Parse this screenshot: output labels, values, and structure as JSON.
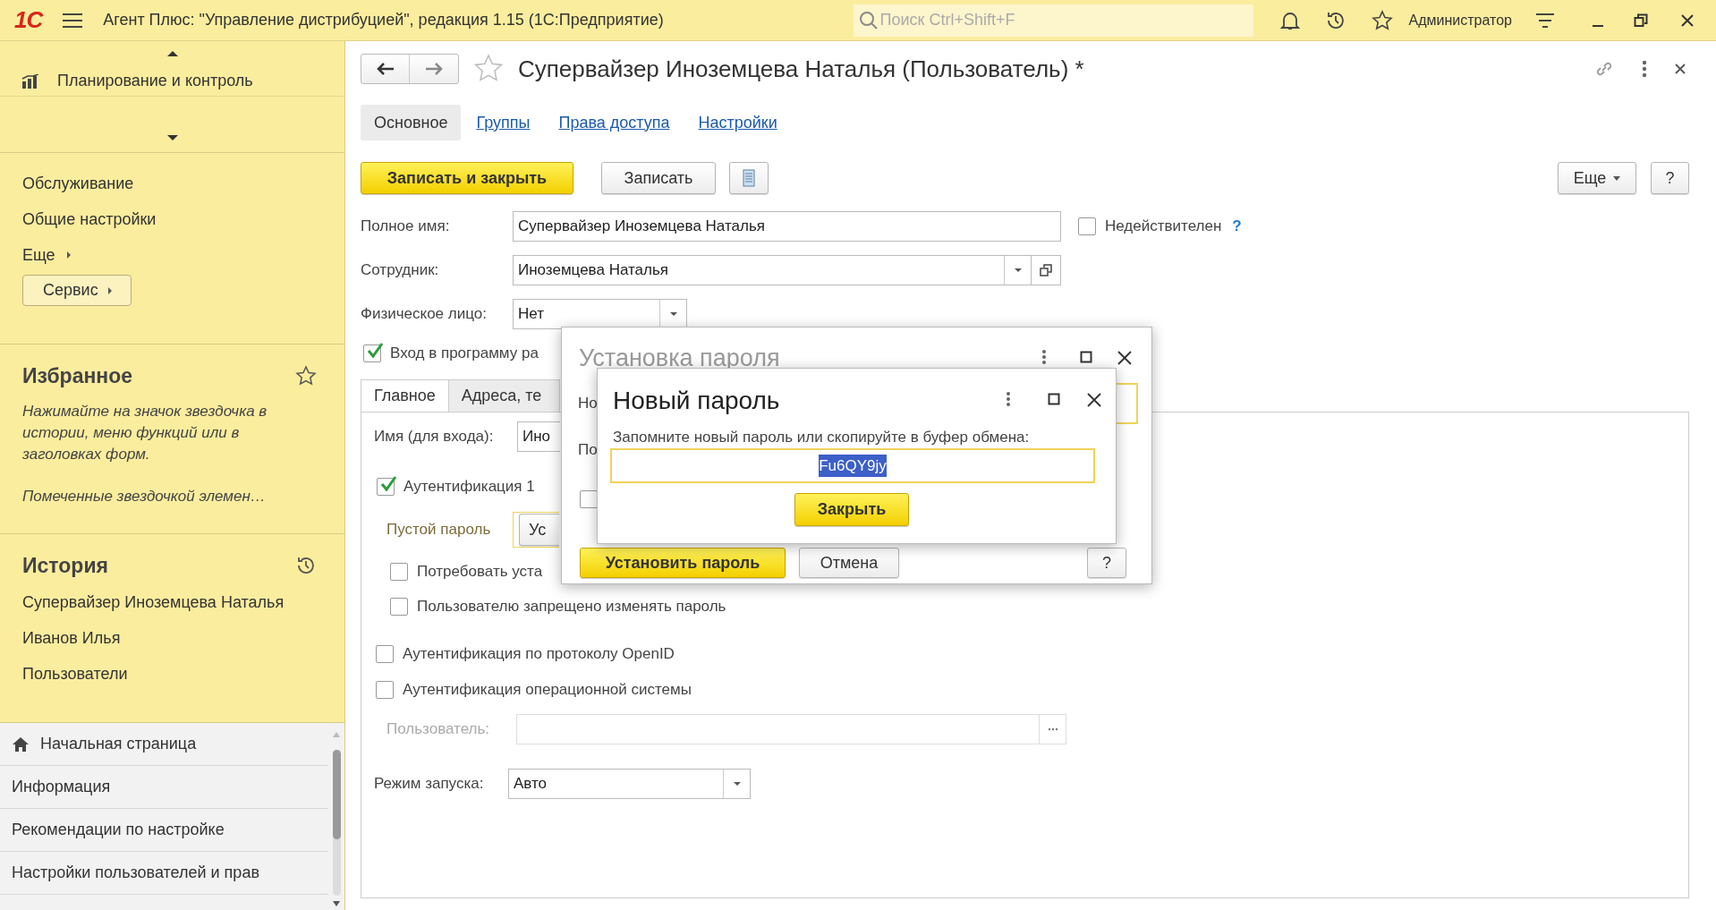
{
  "window": {
    "logo": "1С",
    "title": "Агент Плюс: \"Управление дистрибуцией\", редакция 1.15  (1С:Предприятие)",
    "search": {
      "placeholder": "Поиск Ctrl+Shift+F"
    },
    "user": "Администратор"
  },
  "sidebar": {
    "sections": [
      {
        "label": "Планирование и контроль"
      }
    ],
    "functions": [
      {
        "label": "Обслуживание",
        "kind": "link"
      },
      {
        "label": "Общие настройки",
        "kind": "link"
      },
      {
        "label": "Еще",
        "kind": "submenu"
      },
      {
        "label": "Сервис",
        "kind": "button"
      }
    ],
    "favorites": {
      "title": "Избранное",
      "hint": "Нажимайте на значок звездочка в истории, меню функций или в заголовках форм.",
      "note": "Помеченные звездочкой элемен…"
    },
    "history": {
      "title": "История",
      "items": [
        "Супервайзер Иноземцева Наталья",
        "Иванов Илья",
        "Пользователи"
      ]
    },
    "open_windows": [
      {
        "label": "Начальная страница",
        "kind": "home"
      },
      {
        "label": "Информация",
        "kind": "page"
      },
      {
        "label": "Рекомендации по настройке",
        "kind": "page"
      },
      {
        "label": "Настройки пользователей и прав",
        "kind": "page"
      }
    ]
  },
  "form": {
    "title": "Супервайзер Иноземцева Наталья (Пользователь) *",
    "tabs": [
      {
        "label": "Основное",
        "selected": true
      },
      {
        "label": "Группы",
        "selected": false
      },
      {
        "label": "Права доступа",
        "selected": false
      },
      {
        "label": "Настройки",
        "selected": false
      }
    ],
    "commands": {
      "save_close": "Записать и закрыть",
      "save": "Записать",
      "more": "Еще",
      "help": "?"
    },
    "full_name": {
      "label": "Полное имя:",
      "value": "Супервайзер Иноземцева Наталья"
    },
    "inactive": {
      "label": "Недействителен",
      "checked": false,
      "help": "?"
    },
    "employee": {
      "label": "Сотрудник:",
      "value": "Иноземцева Наталья"
    },
    "person": {
      "label": "Физическое лицо:",
      "value": "Нет"
    },
    "login_allowed": {
      "label": "Вход в программу ра",
      "checked": true
    },
    "inner_tabs": [
      {
        "label": "Главное",
        "selected": true
      },
      {
        "label": "Адреса, те",
        "selected": false
      }
    ],
    "login_name": {
      "label": "Имя (для входа):",
      "value": "Ино"
    },
    "auth_1c": {
      "label": "Аутентификация 1",
      "checked": true
    },
    "empty_password": {
      "label": "Пустой пароль",
      "button": "Ус"
    },
    "options": [
      {
        "label": "Потребовать уста",
        "checked": false
      },
      {
        "label": "Пользователю запрещено изменять пароль",
        "checked": false
      }
    ],
    "auth_other": [
      {
        "label": "Аутентификация по протоколу OpenID",
        "checked": false
      },
      {
        "label": "Аутентификация операционной системы",
        "checked": false
      }
    ],
    "os_user": {
      "label": "Пользователь:",
      "disabled": true
    },
    "launch_mode": {
      "label": "Режим запуска:",
      "value": "Авто"
    }
  },
  "set_password_dialog": {
    "title": "Установка пароля",
    "labels": [
      "Но",
      "По"
    ],
    "checkbox": {
      "checked": false
    },
    "buttons": {
      "ok": "Установить пароль",
      "cancel": "Отмена",
      "help": "?"
    }
  },
  "new_password_dialog": {
    "title": "Новый пароль",
    "message": "Запомните новый пароль или скопируйте в буфер обмена:",
    "password": {
      "value": "Fu6QY9jy",
      "selected": true
    },
    "close": "Закрыть"
  }
}
